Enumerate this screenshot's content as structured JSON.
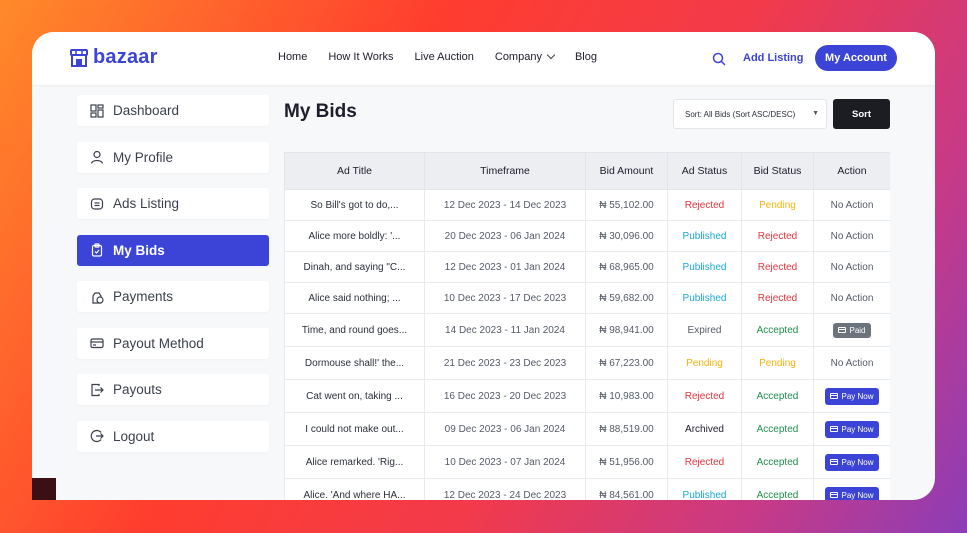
{
  "brand": {
    "name": "bazaar",
    "color": "#3b44d6"
  },
  "nav": [
    "Home",
    "How It Works",
    "Live Auction",
    "Company",
    "Blog"
  ],
  "header": {
    "add_listing": "Add Listing",
    "account": "My Account"
  },
  "sidebar": {
    "items": [
      {
        "label": "Dashboard",
        "icon": "dashboard-icon"
      },
      {
        "label": "My Profile",
        "icon": "user-icon"
      },
      {
        "label": "Ads Listing",
        "icon": "ads-icon"
      },
      {
        "label": "My Bids",
        "icon": "bids-icon",
        "active": true
      },
      {
        "label": "Payments",
        "icon": "payments-icon"
      },
      {
        "label": "Payout Method",
        "icon": "card-icon"
      },
      {
        "label": "Payouts",
        "icon": "payout-icon"
      },
      {
        "label": "Logout",
        "icon": "logout-icon"
      }
    ]
  },
  "main": {
    "title": "My Bids",
    "sort_select": "Sort: All Bids (Sort ASC/DESC)",
    "sort_button": "Sort"
  },
  "table": {
    "headers": [
      "Ad Title",
      "Timeframe",
      "Bid Amount",
      "Ad Status",
      "Bid Status",
      "Action"
    ],
    "rows": [
      {
        "title": "So Bill's got to do,...",
        "timeframe": "12 Dec 2023 - 14 Dec 2023",
        "amount": "₦ 55,102.00",
        "ad_status": "Rejected",
        "bid_status": "Pending",
        "action": "No Action"
      },
      {
        "title": "Alice more boldly: '...",
        "timeframe": "20 Dec 2023 - 06 Jan 2024",
        "amount": "₦ 30,096.00",
        "ad_status": "Published",
        "bid_status": "Rejected",
        "action": "No Action"
      },
      {
        "title": "Dinah, and saying \"C...",
        "timeframe": "12 Dec 2023 - 01 Jan 2024",
        "amount": "₦ 68,965.00",
        "ad_status": "Published",
        "bid_status": "Rejected",
        "action": "No Action"
      },
      {
        "title": "Alice said nothing; ...",
        "timeframe": "10 Dec 2023 - 17 Dec 2023",
        "amount": "₦ 59,682.00",
        "ad_status": "Published",
        "bid_status": "Rejected",
        "action": "No Action"
      },
      {
        "title": "Time, and round goes...",
        "timeframe": "14 Dec 2023 - 11 Jan 2024",
        "amount": "₦ 98,941.00",
        "ad_status": "Expired",
        "bid_status": "Accepted",
        "action": "Paid"
      },
      {
        "title": "Dormouse shall!' the...",
        "timeframe": "21 Dec 2023 - 23 Dec 2023",
        "amount": "₦ 67,223.00",
        "ad_status": "Pending",
        "bid_status": "Pending",
        "action": "No Action"
      },
      {
        "title": "Cat went on, taking ...",
        "timeframe": "16 Dec 2023 - 20 Dec 2023",
        "amount": "₦ 10,983.00",
        "ad_status": "Rejected",
        "bid_status": "Accepted",
        "action": "Pay Now"
      },
      {
        "title": "I could not make out...",
        "timeframe": "09 Dec 2023 - 06 Jan 2024",
        "amount": "₦ 88,519.00",
        "ad_status": "Archived",
        "bid_status": "Accepted",
        "action": "Pay Now"
      },
      {
        "title": "Alice remarked. 'Rig...",
        "timeframe": "10 Dec 2023 - 07 Jan 2024",
        "amount": "₦ 51,956.00",
        "ad_status": "Rejected",
        "bid_status": "Accepted",
        "action": "Pay Now"
      },
      {
        "title": "Alice. 'And where HA...",
        "timeframe": "12 Dec 2023 - 24 Dec 2023",
        "amount": "₦ 84,561.00",
        "ad_status": "Published",
        "bid_status": "Accepted",
        "action": "Pay Now"
      }
    ]
  },
  "status_colors": {
    "Rejected": "#e5343d",
    "Published": "#16a8d8",
    "Pending": "#f2b20a",
    "Accepted": "#1f8f4c",
    "Expired": "#555b66",
    "Archived": "#1d1d2b"
  }
}
